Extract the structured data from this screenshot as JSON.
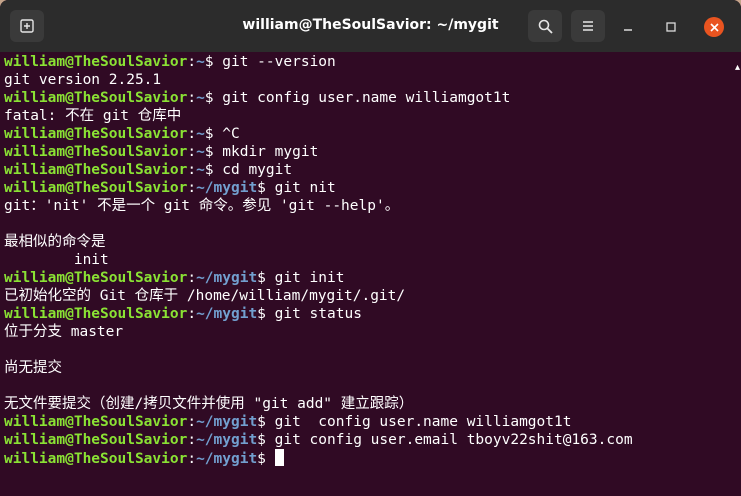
{
  "window": {
    "title": "william@TheSoulSavior: ~/mygit"
  },
  "icons": {
    "new_tab": "new-tab-icon",
    "search": "search-icon",
    "menu": "hamburger-menu-icon",
    "minimize": "minimize-icon",
    "maximize": "maximize-icon",
    "close": "close-icon"
  },
  "colors": {
    "terminal_bg": "#300a24",
    "prompt_user": "#8ae234",
    "prompt_path": "#729fcf",
    "close_button": "#e95420"
  },
  "terminal": {
    "lines": [
      {
        "type": "prompt",
        "user": "william@TheSoulSavior",
        "sep": ":",
        "path": "~",
        "sym": "$ ",
        "cmd": "git --version"
      },
      {
        "type": "output",
        "text": "git version 2.25.1"
      },
      {
        "type": "prompt",
        "user": "william@TheSoulSavior",
        "sep": ":",
        "path": "~",
        "sym": "$ ",
        "cmd": "git config user.name williamgot1t"
      },
      {
        "type": "output",
        "text": "fatal: 不在 git 仓库中"
      },
      {
        "type": "prompt",
        "user": "william@TheSoulSavior",
        "sep": ":",
        "path": "~",
        "sym": "$ ",
        "cmd": "^C"
      },
      {
        "type": "prompt",
        "user": "william@TheSoulSavior",
        "sep": ":",
        "path": "~",
        "sym": "$ ",
        "cmd": "mkdir mygit"
      },
      {
        "type": "prompt",
        "user": "william@TheSoulSavior",
        "sep": ":",
        "path": "~",
        "sym": "$ ",
        "cmd": "cd mygit"
      },
      {
        "type": "prompt",
        "user": "william@TheSoulSavior",
        "sep": ":",
        "path": "~/mygit",
        "sym": "$ ",
        "cmd": "git nit"
      },
      {
        "type": "output",
        "text": "git：'nit' 不是一个 git 命令。参见 'git --help'。"
      },
      {
        "type": "output",
        "text": ""
      },
      {
        "type": "output",
        "text": "最相似的命令是"
      },
      {
        "type": "output",
        "text": "        init"
      },
      {
        "type": "prompt",
        "user": "william@TheSoulSavior",
        "sep": ":",
        "path": "~/mygit",
        "sym": "$ ",
        "cmd": "git init"
      },
      {
        "type": "output",
        "text": "已初始化空的 Git 仓库于 /home/william/mygit/.git/"
      },
      {
        "type": "prompt",
        "user": "william@TheSoulSavior",
        "sep": ":",
        "path": "~/mygit",
        "sym": "$ ",
        "cmd": "git status"
      },
      {
        "type": "output",
        "text": "位于分支 master"
      },
      {
        "type": "output",
        "text": ""
      },
      {
        "type": "output",
        "text": "尚无提交"
      },
      {
        "type": "output",
        "text": ""
      },
      {
        "type": "output",
        "text": "无文件要提交（创建/拷贝文件并使用 \"git add\" 建立跟踪）"
      },
      {
        "type": "prompt",
        "user": "william@TheSoulSavior",
        "sep": ":",
        "path": "~/mygit",
        "sym": "$ ",
        "cmd": "git  config user.name williamgot1t"
      },
      {
        "type": "prompt",
        "user": "william@TheSoulSavior",
        "sep": ":",
        "path": "~/mygit",
        "sym": "$ ",
        "cmd": "git config user.email tboyv22shit@163.com"
      },
      {
        "type": "prompt",
        "user": "william@TheSoulSavior",
        "sep": ":",
        "path": "~/mygit",
        "sym": "$ ",
        "cmd": "",
        "cursor": true
      }
    ]
  }
}
